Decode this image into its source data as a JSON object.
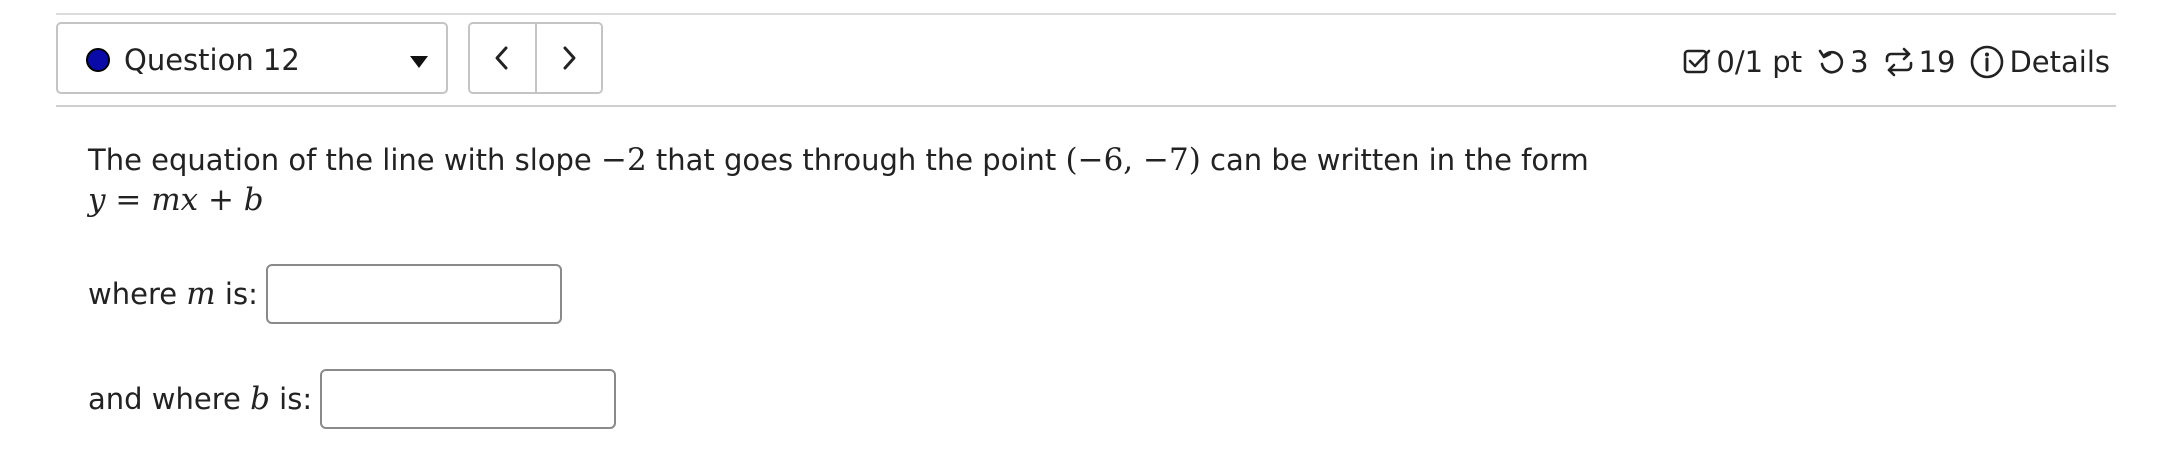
{
  "header": {
    "question_label": "Question 12",
    "status_dot_color": "#0a0aa8",
    "prev_icon": "chevron-left-icon",
    "next_icon": "chevron-right-icon"
  },
  "stats": {
    "score": "0/1 pt",
    "score_icon": "checkbox-icon",
    "attempts": "3",
    "attempts_icon": "retry-icon",
    "versions": "19",
    "versions_icon": "repeat-icon",
    "details": "Details",
    "details_icon": "info-icon"
  },
  "question": {
    "text_before_slope": "The equation of the line with slope ",
    "slope": "−2",
    "text_before_point": " that goes through the point ",
    "point": "(−6, −7)",
    "text_after_point": " can be written in the form",
    "form_y": "y",
    "form_eq": " = ",
    "form_m": "m",
    "form_x": "x",
    "form_plus": " + ",
    "form_b": "b"
  },
  "answers": {
    "m_prefix": "where ",
    "m_var": "m",
    "m_suffix": " is:",
    "m_value": "",
    "b_prefix": "and where ",
    "b_var": "b",
    "b_suffix": " is:",
    "b_value": ""
  }
}
